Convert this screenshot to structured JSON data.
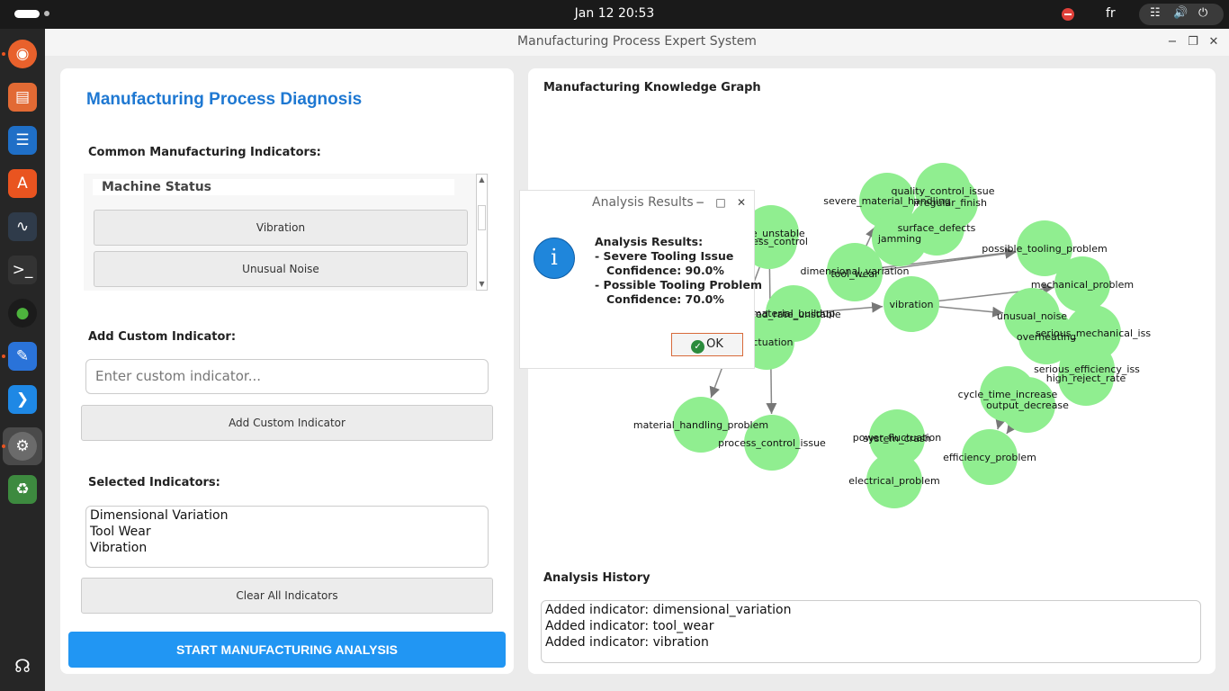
{
  "topbar": {
    "clock": "Jan 12  20:53",
    "lang": "fr"
  },
  "window": {
    "title": "Manufacturing Process Expert System"
  },
  "left": {
    "heading": "Manufacturing Process Diagnosis",
    "common_label": "Common Manufacturing Indicators:",
    "group_label": "Machine Status",
    "indicators": [
      "Vibration",
      "Unusual Noise"
    ],
    "custom_label": "Add Custom Indicator:",
    "custom_placeholder": "Enter custom indicator...",
    "add_button": "Add Custom Indicator",
    "selected_label": "Selected Indicators:",
    "selected": [
      "Dimensional Variation",
      "Tool Wear",
      "Vibration"
    ],
    "clear_button": "Clear All Indicators",
    "start_button": "START MANUFACTURING ANALYSIS"
  },
  "right": {
    "graph_title": "Manufacturing Knowledge Graph",
    "history_label": "Analysis History",
    "history": [
      "Added indicator: dimensional_variation",
      "Added indicator: tool_wear",
      "Added indicator: vibration"
    ]
  },
  "graph": {
    "node_color": "#90ee90",
    "nodes": [
      "quality_control_issue",
      "irregular_finish",
      "severe_material_handling",
      "jamming",
      "surface_defects",
      "rate_unstable",
      "process_control",
      "dimensional_variation",
      "tool_wear",
      "possible_tooling_problem",
      "mechanical_problem",
      "vibration",
      "material_buildup",
      "feed_rate_unstable",
      "unusual_noise",
      "overheating",
      "serious_mechanical_iss",
      "fluctuation",
      "serious_efficiency_iss",
      "high_reject_rate",
      "cycle_time_increase",
      "output_decrease",
      "material_handling_problem",
      "process_control_issue",
      "power_fluctuation",
      "system_crash",
      "efficiency_problem",
      "electrical_problem"
    ]
  },
  "dialog": {
    "title": "Analysis Results",
    "message": "Analysis Results:\n- Severe Tooling Issue\n   Confidence: 90.0%\n- Possible Tooling Problem\n   Confidence: 70.0%",
    "ok": "OK"
  }
}
